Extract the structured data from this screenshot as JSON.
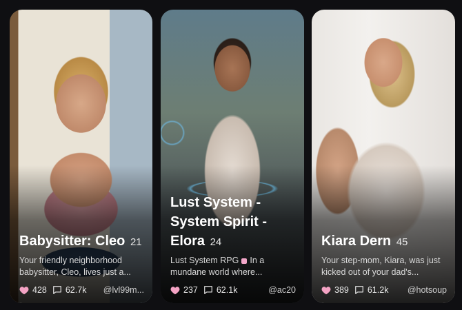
{
  "cards": [
    {
      "title": "Babysitter: Cleo",
      "age": "21",
      "description": "Your friendly neighborhood babysitter, Cleo, lives just a...",
      "likes": "428",
      "messages": "62.7k",
      "author": "@lvl99m..."
    },
    {
      "title": "Lust System - System Spirit - Elora",
      "age": "24",
      "description_before": "Lust System RPG",
      "description_after": "In a mundane world where...",
      "likes": "237",
      "messages": "62.1k",
      "author": "@ac20"
    },
    {
      "title": "Kiara Dern",
      "age": "45",
      "description": "Your step-mom, Kiara, was just kicked out of your dad's...",
      "likes": "389",
      "messages": "61.2k",
      "author": "@hotsoup"
    }
  ],
  "icons": {
    "like": "heart-icon",
    "messages": "chat-bubble-icon"
  },
  "colors": {
    "background": "#0f0f12",
    "heart": "#f4a3c4",
    "badge": "#f2a6c8"
  }
}
